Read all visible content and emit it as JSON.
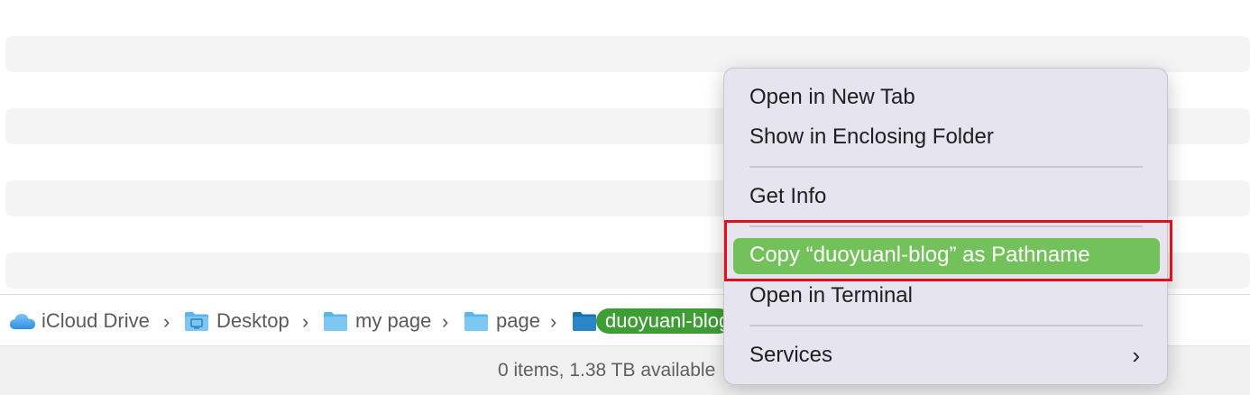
{
  "path_bar": {
    "crumbs": [
      {
        "label": "iCloud Drive",
        "icon": "cloud-icon"
      },
      {
        "label": "Desktop",
        "icon": "desktop-folder-icon"
      },
      {
        "label": "my page",
        "icon": "folder-icon"
      },
      {
        "label": "page",
        "icon": "folder-icon"
      },
      {
        "label": "duoyuanl-blog",
        "icon": "folder-icon"
      }
    ],
    "separator": "›"
  },
  "status_bar": {
    "text": "0 items, 1.38 TB available"
  },
  "context_menu": {
    "items": [
      {
        "label": "Open in New Tab"
      },
      {
        "label": "Show in Enclosing Folder"
      },
      {
        "label": "Get Info"
      },
      {
        "label": "Copy “duoyuanl-blog” as Pathname",
        "highlighted": true
      },
      {
        "label": "Open in Terminal"
      },
      {
        "label": "Services",
        "submenu_arrow": "›"
      }
    ]
  },
  "colors": {
    "highlight": "#73c15b",
    "current_folder_pill": "#3f9d35",
    "annotation_box": "#e0101c",
    "folder_icon": "#5bb4ea"
  }
}
